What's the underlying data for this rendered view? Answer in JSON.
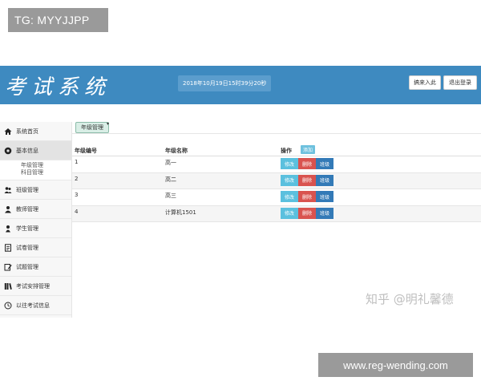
{
  "overlay_tag": "TG: MYYJJPP",
  "header": {
    "logo_text": "考试系统",
    "datetime": "2018年10月19日15时39分20秒",
    "enter_button": "搞来入此",
    "logout_button": "退出登录",
    "bg_color": "#3e8ac0"
  },
  "sidebar": {
    "items": [
      {
        "label": "系统首页",
        "icon": "home-icon"
      },
      {
        "label": "基本信息",
        "icon": "gear-icon",
        "active": true,
        "sub": [
          "年级管理",
          "科目管理"
        ]
      },
      {
        "label": "班级管理",
        "icon": "users-icon"
      },
      {
        "label": "教师管理",
        "icon": "user-icon"
      },
      {
        "label": "学生管理",
        "icon": "user-icon"
      },
      {
        "label": "试卷管理",
        "icon": "document-icon"
      },
      {
        "label": "试题管理",
        "icon": "edit-icon"
      },
      {
        "label": "考试安排管理",
        "icon": "books-icon"
      },
      {
        "label": "以往考试信息",
        "icon": "clock-icon"
      }
    ]
  },
  "breadcrumb": "年级管理",
  "table": {
    "headers": {
      "id": "年级编号",
      "name": "年级名称",
      "ops": "操作",
      "add": "添加"
    },
    "rows": [
      {
        "id": "1",
        "name": "高一"
      },
      {
        "id": "2",
        "name": "高二"
      },
      {
        "id": "3",
        "name": "高三"
      },
      {
        "id": "4",
        "name": "计算机1501"
      }
    ],
    "actions": {
      "edit": "修改",
      "delete": "删除",
      "class": "班级"
    }
  },
  "watermark": "知乎 @明礼馨德",
  "overlay_url": "www.reg-wending.com",
  "colors": {
    "edit": "#5bc0de",
    "delete": "#d9534f",
    "class": "#337ab7",
    "add": "#6ec1de"
  }
}
